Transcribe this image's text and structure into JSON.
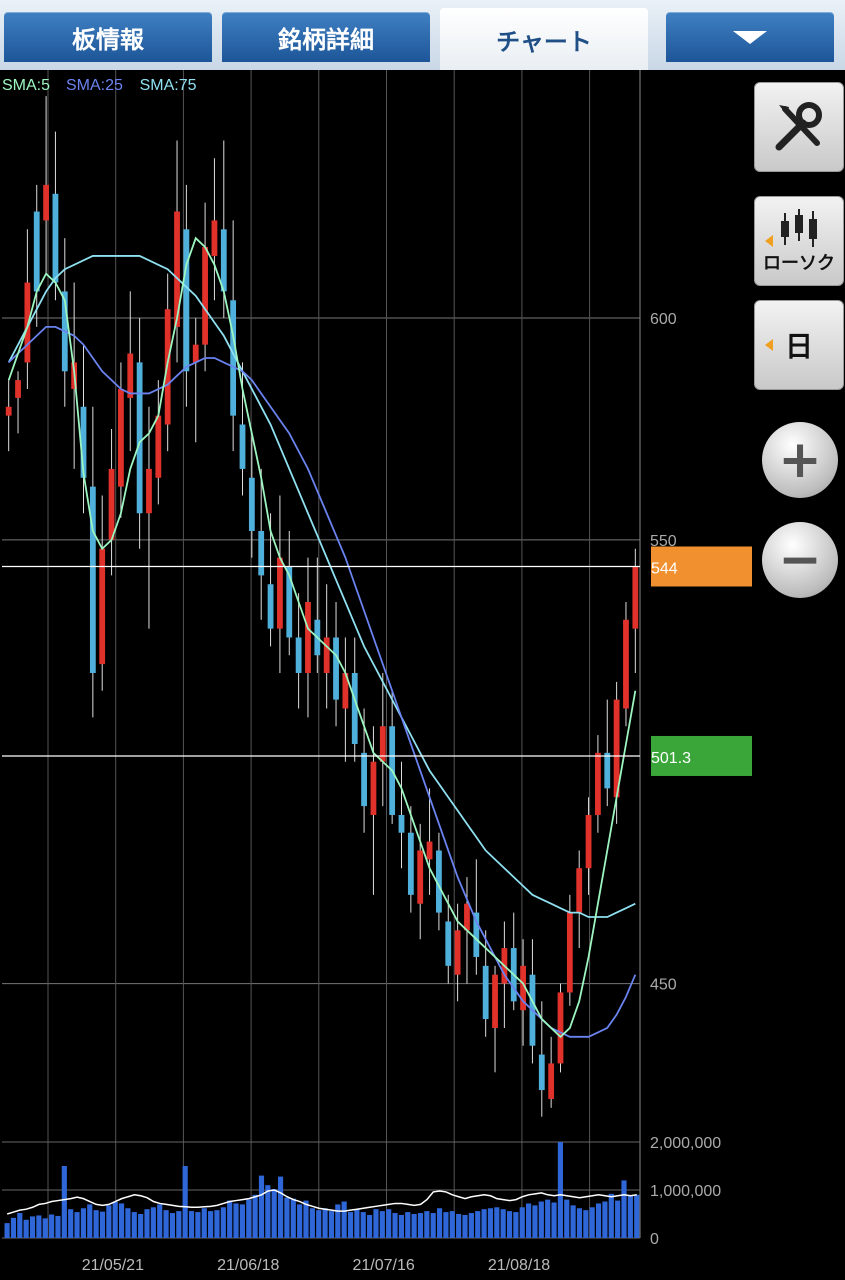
{
  "tabs": [
    {
      "label": "板情報"
    },
    {
      "label": "銘柄詳細"
    },
    {
      "label": "チャート"
    }
  ],
  "side": {
    "candle_label": "ローソク",
    "period_label": "日",
    "zoom_in": "+",
    "zoom_out": "−"
  },
  "icons": {
    "tools": "tools-icon",
    "candle": "candlestick-icon",
    "menu": "dropdown-arrow-icon"
  },
  "colors": {
    "up": "#e0312a",
    "down": "#4fb0dc",
    "sma5": "#9df5c0",
    "sma25": "#6a83f0",
    "sma75": "#8fe0f0",
    "volume": "#2f66d8",
    "last_price_tag": "#f0902e",
    "sma5_tag": "#3aa63a"
  },
  "chart_data": {
    "type": "candlestick",
    "legend": [
      {
        "name": "SMA:5",
        "color": "#9df5c0"
      },
      {
        "name": "SMA:25",
        "color": "#6a83f0"
      },
      {
        "name": "SMA:75",
        "color": "#8fe0f0"
      }
    ],
    "price_axis": {
      "ylim": [
        417,
        655
      ],
      "ticks": [
        600,
        550,
        450
      ]
    },
    "volume_axis": {
      "ylim": [
        0,
        2000000
      ],
      "ticks": [
        "2,000,000",
        "1,000,000",
        "0"
      ]
    },
    "date_labels": [
      {
        "label": "21/05/21",
        "index": 10
      },
      {
        "label": "21/06/18",
        "index": 30
      },
      {
        "label": "21/07/16",
        "index": 50
      },
      {
        "label": "21/08/18",
        "index": 70
      }
    ],
    "tags": [
      {
        "text": "544",
        "value": 544,
        "color": "#f0902e"
      },
      {
        "text": "501.3",
        "value": 501.3,
        "color": "#3aa63a"
      }
    ],
    "candles": [
      [
        580,
        586,
        570,
        578,
        1
      ],
      [
        582,
        588,
        574,
        586,
        1
      ],
      [
        590,
        620,
        584,
        608,
        1
      ],
      [
        606,
        630,
        598,
        624,
        0
      ],
      [
        622,
        650,
        610,
        630,
        1
      ],
      [
        628,
        642,
        604,
        608,
        0
      ],
      [
        606,
        618,
        580,
        588,
        0
      ],
      [
        590,
        608,
        566,
        584,
        1
      ],
      [
        580,
        594,
        556,
        564,
        0
      ],
      [
        562,
        580,
        510,
        520,
        0
      ],
      [
        522,
        560,
        516,
        548,
        1
      ],
      [
        550,
        575,
        542,
        566,
        1
      ],
      [
        562,
        590,
        555,
        584,
        1
      ],
      [
        582,
        606,
        570,
        592,
        1
      ],
      [
        590,
        600,
        548,
        556,
        0
      ],
      [
        556,
        580,
        530,
        566,
        1
      ],
      [
        564,
        586,
        558,
        578,
        1
      ],
      [
        576,
        610,
        570,
        602,
        1
      ],
      [
        598,
        640,
        590,
        624,
        1
      ],
      [
        620,
        630,
        580,
        588,
        0
      ],
      [
        590,
        600,
        572,
        594,
        1
      ],
      [
        594,
        626,
        588,
        616,
        1
      ],
      [
        614,
        636,
        604,
        622,
        1
      ],
      [
        620,
        640,
        600,
        606,
        0
      ],
      [
        604,
        622,
        570,
        578,
        0
      ],
      [
        576,
        590,
        560,
        566,
        0
      ],
      [
        564,
        574,
        546,
        552,
        0
      ],
      [
        552,
        566,
        532,
        542,
        0
      ],
      [
        540,
        556,
        526,
        530,
        0
      ],
      [
        530,
        560,
        520,
        546,
        1
      ],
      [
        544,
        552,
        524,
        528,
        0
      ],
      [
        528,
        538,
        512,
        520,
        0
      ],
      [
        520,
        546,
        510,
        536,
        1
      ],
      [
        532,
        546,
        520,
        524,
        0
      ],
      [
        520,
        540,
        512,
        528,
        1
      ],
      [
        528,
        536,
        508,
        514,
        0
      ],
      [
        512,
        528,
        500,
        520,
        1
      ],
      [
        520,
        528,
        500,
        504,
        0
      ],
      [
        502,
        512,
        484,
        490,
        0
      ],
      [
        488,
        508,
        470,
        500,
        1
      ],
      [
        500,
        520,
        490,
        508,
        1
      ],
      [
        508,
        516,
        486,
        488,
        0
      ],
      [
        488,
        500,
        476,
        484,
        0
      ],
      [
        484,
        490,
        466,
        470,
        0
      ],
      [
        468,
        486,
        460,
        480,
        1
      ],
      [
        478,
        494,
        470,
        482,
        1
      ],
      [
        480,
        484,
        462,
        466,
        0
      ],
      [
        464,
        470,
        450,
        454,
        0
      ],
      [
        452,
        468,
        446,
        462,
        1
      ],
      [
        462,
        474,
        450,
        468,
        1
      ],
      [
        466,
        478,
        452,
        456,
        0
      ],
      [
        454,
        462,
        438,
        442,
        0
      ],
      [
        440,
        454,
        430,
        452,
        1
      ],
      [
        450,
        464,
        440,
        458,
        1
      ],
      [
        458,
        466,
        444,
        446,
        0
      ],
      [
        444,
        460,
        436,
        454,
        1
      ],
      [
        452,
        460,
        432,
        436,
        0
      ],
      [
        434,
        446,
        420,
        426,
        0
      ],
      [
        424,
        438,
        422,
        432,
        1
      ],
      [
        432,
        450,
        430,
        448,
        1
      ],
      [
        448,
        470,
        445,
        466,
        1
      ],
      [
        466,
        480,
        458,
        476,
        1
      ],
      [
        476,
        492,
        470,
        488,
        1
      ],
      [
        488,
        506,
        484,
        502,
        1
      ],
      [
        502,
        514,
        490,
        494,
        0
      ],
      [
        492,
        518,
        486,
        514,
        1
      ],
      [
        512,
        536,
        508,
        532,
        1
      ],
      [
        530,
        548,
        520,
        544,
        1
      ]
    ],
    "sma5": [
      586,
      592,
      598,
      606,
      610,
      608,
      604,
      588,
      565,
      552,
      548,
      550,
      556,
      566,
      572,
      574,
      578,
      590,
      600,
      612,
      618,
      616,
      612,
      606,
      596,
      584,
      574,
      564,
      552,
      546,
      542,
      536,
      530,
      528,
      526,
      524,
      520,
      514,
      508,
      502,
      500,
      498,
      494,
      488,
      482,
      476,
      472,
      468,
      464,
      462,
      460,
      458,
      456,
      454,
      452,
      450,
      446,
      442,
      440,
      438,
      440,
      446,
      456,
      468,
      480,
      492,
      504,
      516
    ],
    "sma25": [
      590,
      592,
      594,
      596,
      598,
      598,
      597,
      596,
      594,
      591,
      588,
      586,
      584,
      583,
      583,
      583,
      584,
      585,
      587,
      589,
      590,
      591,
      591,
      590,
      589,
      588,
      586,
      583,
      580,
      577,
      574,
      570,
      566,
      561,
      556,
      551,
      546,
      540,
      534,
      528,
      522,
      516,
      510,
      504,
      498,
      492,
      486,
      480,
      474,
      469,
      464,
      460,
      456,
      452,
      449,
      446,
      444,
      442,
      440,
      439,
      438,
      438,
      438,
      439,
      440,
      443,
      447,
      452
    ],
    "sma75": [
      590,
      594,
      598,
      602,
      606,
      609,
      611,
      612,
      613,
      614,
      614,
      614,
      614,
      614,
      614,
      613,
      612,
      611,
      609,
      607,
      605,
      602,
      599,
      596,
      592,
      588,
      584,
      580,
      576,
      571,
      566,
      561,
      556,
      551,
      546,
      541,
      536,
      531,
      526,
      522,
      518,
      514,
      510,
      506,
      502,
      498,
      495,
      492,
      489,
      486,
      483,
      480,
      478,
      476,
      474,
      472,
      470,
      469,
      468,
      467,
      466,
      466,
      465,
      465,
      465,
      466,
      467,
      468
    ],
    "volume": [
      310000,
      420000,
      520000,
      380000,
      450000,
      470000,
      410000,
      490000,
      460000,
      1500000,
      600000,
      540000,
      620000,
      700000,
      580000,
      550000,
      680000,
      750000,
      720000,
      620000,
      540000,
      500000,
      600000,
      640000,
      700000,
      580000,
      520000,
      560000,
      1500000,
      560000,
      540000,
      620000,
      560000,
      580000,
      640000,
      780000,
      720000,
      700000,
      800000,
      900000,
      1300000,
      1100000,
      1020000,
      1280000,
      840000,
      820000,
      700000,
      780000,
      620000,
      580000,
      620000,
      560000,
      700000,
      760000,
      540000,
      600000,
      540000,
      480000,
      600000,
      560000,
      600000,
      520000,
      480000,
      540000,
      500000,
      520000,
      560000,
      520000,
      620000,
      540000,
      560000,
      500000,
      480000,
      520000,
      560000,
      600000,
      620000,
      640000,
      600000,
      560000,
      540000,
      640000,
      720000,
      680000,
      760000,
      800000,
      740000,
      2000000,
      800000,
      680000,
      620000,
      580000,
      640000,
      720000,
      760000,
      920000,
      780000,
      1200000,
      880000,
      900000
    ],
    "volume_sma": [
      500000,
      540000,
      580000,
      600000,
      640000,
      700000,
      720000,
      760000,
      780000,
      800000,
      820000,
      850000,
      820000,
      760000,
      700000,
      680000,
      700000,
      760000,
      820000,
      860000,
      900000,
      880000,
      840000,
      760000,
      720000,
      700000,
      680000,
      660000,
      650000,
      640000,
      640000,
      650000,
      660000,
      680000,
      720000,
      760000,
      780000,
      800000,
      820000,
      860000,
      900000,
      980000,
      1000000,
      940000,
      860000,
      800000,
      760000,
      700000,
      660000,
      620000,
      600000,
      580000,
      560000,
      560000,
      580000,
      600000,
      620000,
      640000,
      660000,
      680000,
      700000,
      720000,
      720000,
      700000,
      680000,
      700000,
      800000,
      960000,
      980000,
      960000,
      900000,
      860000,
      820000,
      860000,
      880000,
      900000,
      880000,
      820000,
      800000,
      780000,
      800000,
      860000,
      900000,
      920000,
      940000,
      900000,
      880000,
      900000,
      880000,
      860000,
      840000,
      860000,
      880000,
      900000,
      880000,
      860000,
      880000,
      900000,
      880000,
      900000
    ]
  }
}
